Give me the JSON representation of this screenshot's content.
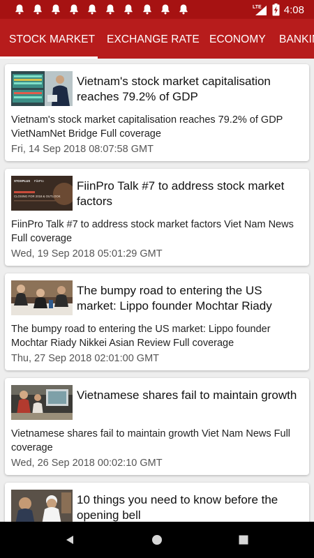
{
  "status_bar": {
    "notification_icons": [
      "bell-icon",
      "bell-icon",
      "bell-icon",
      "bell-icon",
      "bell-icon",
      "bell-icon",
      "bell-icon",
      "bell-icon",
      "bell-icon",
      "bell-icon"
    ],
    "network": "LTE",
    "time": "4:08"
  },
  "tabs": [
    {
      "label": "STOCK MARKET",
      "active": true
    },
    {
      "label": "EXCHANGE RATE",
      "active": false
    },
    {
      "label": "ECONOMY",
      "active": false
    },
    {
      "label": "BANKIN",
      "active": false
    }
  ],
  "articles": [
    {
      "headline": "Vietnam's stock market capitalisation reaches 79.2% of GDP",
      "summary": "Vietnam's stock market capitalisation reaches 79.2% of GDP",
      "source": "VietNamNet Bridge",
      "coverage": "Full coverage",
      "date": "Fri, 14 Sep 2018 08:07:58 GMT"
    },
    {
      "headline": "FiinPro Talk #7 to address stock market factors",
      "summary": "FiinPro Talk #7 to address stock market factors",
      "source": "Viet Nam News",
      "coverage": "Full coverage",
      "date": "Wed, 19 Sep 2018 05:01:29 GMT",
      "thumb_text": [
        "STOXPLUS",
        "FiinPro",
        "CLOSING FOR 2018 & OUTLOOK"
      ]
    },
    {
      "headline": "The bumpy road to entering the US market: Lippo founder Mochtar Riady",
      "summary": "The bumpy road to entering the US market: Lippo founder Mochtar Riady",
      "source": "Nikkei Asian Review",
      "coverage": "Full coverage",
      "date": "Thu, 27 Sep 2018 02:01:00 GMT"
    },
    {
      "headline": "Vietnamese shares fail to maintain growth",
      "summary": "Vietnamese shares fail to maintain growth",
      "source": "Viet Nam News",
      "coverage": "Full coverage",
      "date": "Wed, 26 Sep 2018 00:02:10 GMT"
    },
    {
      "headline": "10 things you need to know before the opening bell"
    }
  ],
  "colors": {
    "status_bar": "#a61212",
    "tab_bar": "#b71c1c",
    "background": "#eeeeee"
  },
  "nav_icons": [
    "back-icon",
    "home-icon",
    "recents-icon"
  ]
}
